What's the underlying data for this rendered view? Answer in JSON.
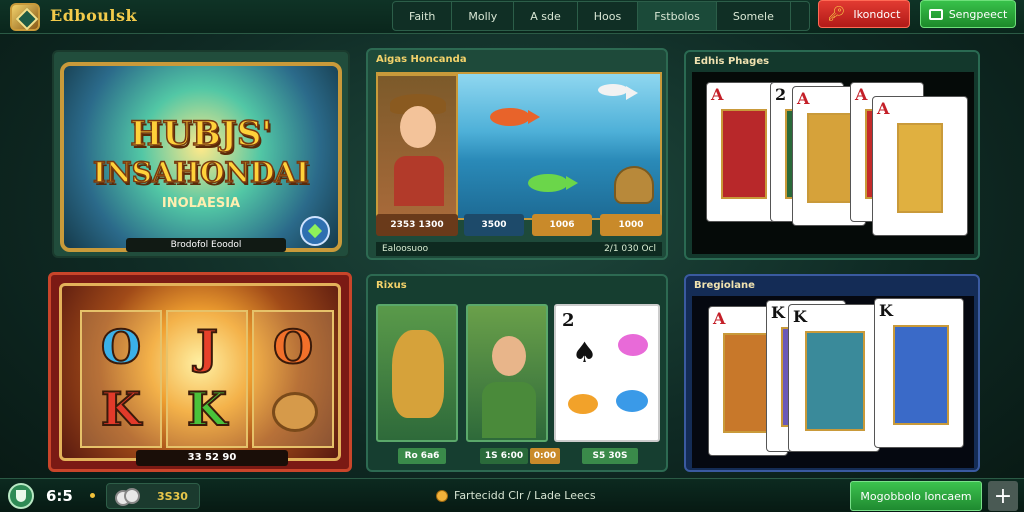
{
  "header": {
    "brand": "Edboulsk",
    "nav": [
      "Faith",
      "Molly",
      "A sde",
      "Hoos",
      "Fstbolos",
      "Somele"
    ],
    "active_nav": 4,
    "login_label": "Ikondoct",
    "register_label": "Sengpeect"
  },
  "panels": {
    "hero": {
      "title_line1": "HUBJS'",
      "title_line2": "INSAHONDAI",
      "subtitle": "INOLAESIA",
      "bar_text": "Brodofol Eoodol"
    },
    "fishing": {
      "title": "Aigas Honcanda",
      "buttons": [
        "2353 1300",
        "3500",
        "1006",
        "1000"
      ],
      "footer_left": "Ealoosuoo",
      "footer_right": "2/1 030  Ocl"
    },
    "cards_top": {
      "title": "Edhis Phages",
      "ranks": [
        "A",
        "2",
        "A",
        "A",
        "A"
      ]
    },
    "slots": {
      "symbols": [
        "O",
        "J",
        "O",
        "K",
        "K",
        "cookie"
      ],
      "bar_text": "33 52 90"
    },
    "middle": {
      "title": "Rixus",
      "card_rank": "2",
      "bars": [
        "Ro 6a6",
        "1S 6:00",
        "0:00",
        "S5 30S"
      ]
    },
    "cards_bottom": {
      "title": "Bregiolane",
      "ranks": [
        "A",
        "K",
        "K",
        "K"
      ]
    }
  },
  "footer": {
    "level": "6:5",
    "balance": "3S30",
    "status": "Fartecidd Clr / Lade Leecs",
    "promo_label": "Mogobbolo Ioncaem"
  },
  "colors": {
    "brand_gold": "#f2ca4b",
    "accent_green": "#38c14a",
    "accent_red": "#e23b32",
    "card_red": "#c41f28"
  },
  "icons": [
    "logo-icon",
    "key-icon",
    "message-icon",
    "shield-icon",
    "coin-icon",
    "star-icon",
    "plus-icon"
  ]
}
